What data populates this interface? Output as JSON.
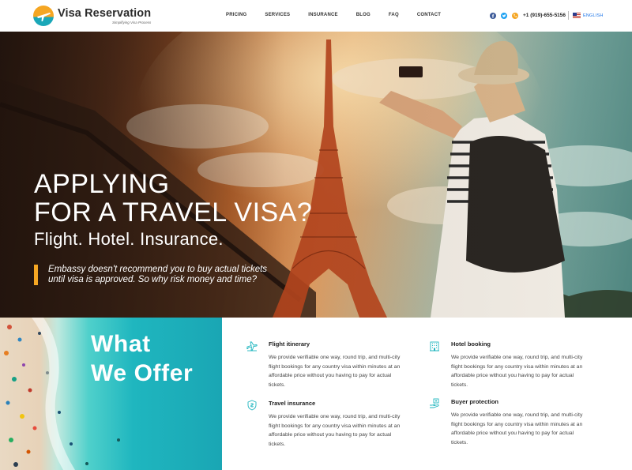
{
  "brand": {
    "name": "Visa Reservation",
    "tagline": "Simplifying Visa Process"
  },
  "nav": {
    "items": [
      "PRICING",
      "SERVICES",
      "INSURANCE",
      "BLOG",
      "FAQ",
      "CONTACT"
    ]
  },
  "header": {
    "phone": "+1 (919)-655-5156",
    "language": "ENGLISH",
    "social_icons": [
      "facebook-icon",
      "twitter-icon",
      "phone-icon"
    ]
  },
  "hero": {
    "title_line1": "APPLYING",
    "title_line2": "FOR A TRAVEL VISA?",
    "subtitle": "Flight. Hotel. Insurance.",
    "quote_line1": "Embassy doesn't recommend you to buy actual tickets",
    "quote_line2": "until visa is approved. So why risk money and time?",
    "accent_color": "#f5a623"
  },
  "offer": {
    "title_line1": "What",
    "title_line2": "We Offer",
    "icon_color": "#1fb6bf",
    "features": [
      {
        "icon": "airplane-icon",
        "title": "Flight itinerary",
        "text": "We provide verifiable one way, round trip, and multi-city flight bookings for any country visa within minutes at an affordable price without you having to pay for actual tickets."
      },
      {
        "icon": "hotel-icon",
        "title": "Hotel booking",
        "text": "We provide verifiable one way, round trip, and multi-city flight bookings for any country visa within minutes at an affordable price without you having to pay for actual tickets."
      },
      {
        "icon": "shield-icon",
        "title": "Travel insurance",
        "text": "We provide verifiable one way, round trip, and multi-city flight bookings for any country visa within minutes at an affordable price without you having to pay for actual tickets."
      },
      {
        "icon": "hand-money-icon",
        "title": "Buyer protection",
        "text": "We provide verifiable one way, round trip, and multi-city flight bookings for any country visa within minutes at an affordable price without you having to pay for actual tickets."
      }
    ]
  }
}
